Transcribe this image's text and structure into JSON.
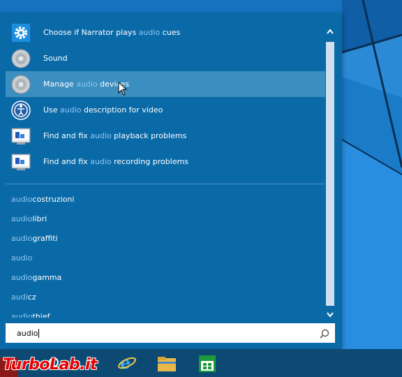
{
  "results": [
    {
      "icon": "gear-icon",
      "parts": [
        "Choose if Narrator plays ",
        "audio",
        " cues"
      ],
      "selected": false
    },
    {
      "icon": "speaker-icon",
      "parts": [
        "Sound",
        "",
        ""
      ],
      "selected": false
    },
    {
      "icon": "speaker-icon",
      "parts": [
        "Manage ",
        "audio",
        " devices"
      ],
      "selected": true
    },
    {
      "icon": "ease-of-access-icon",
      "parts": [
        "Use ",
        "audio",
        " description for video"
      ],
      "selected": false
    },
    {
      "icon": "troubleshooter-icon",
      "parts": [
        "Find and fix ",
        "audio",
        " playback problems"
      ],
      "selected": false
    },
    {
      "icon": "troubleshooter-icon",
      "parts": [
        "Find and fix ",
        "audio",
        " recording problems"
      ],
      "selected": false
    }
  ],
  "suggestions": [
    [
      "audio",
      "costruzioni"
    ],
    [
      "audio",
      "libri"
    ],
    [
      "audio",
      "graffiti"
    ],
    [
      "audio",
      ""
    ],
    [
      "audio",
      "gamma"
    ],
    [
      "audi",
      "cz"
    ],
    [
      "audio",
      "thief"
    ]
  ],
  "search": {
    "value": "audio"
  },
  "watermark": "TurboLab.it",
  "colors": {
    "panel": "#0a6aa8",
    "selected": "#3a8ec0",
    "highlight": "#8fc6f0",
    "taskbar": "#0d4a73"
  }
}
